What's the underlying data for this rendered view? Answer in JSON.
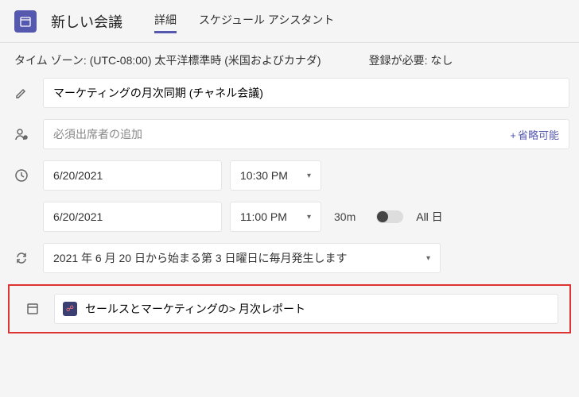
{
  "header": {
    "title": "新しい会議",
    "tabs": {
      "details": "詳細",
      "assistant": "スケジュール アシスタント"
    }
  },
  "subbar": {
    "tz_label": "タイム ゾーン:",
    "tz_value": "(UTC-08:00) 太平洋標準時 (米国およびカナダ)",
    "reg_label": "登録が必要:",
    "reg_value": "なし"
  },
  "form": {
    "title_value": "マーケティングの月次同期 (チャネル会議)",
    "attendees_placeholder": "必須出席者の追加",
    "optional_label": "省略可能",
    "start_date": "6/20/2021",
    "start_time": "10:30 PM",
    "end_date": "6/20/2021",
    "end_time": "11:00 PM",
    "duration": "30m",
    "allday": "All 日",
    "recurrence": "2021 年 6 月 20 日から始まる第 3 日曜日に毎月発生します",
    "channel": "セールスとマーケティングの&gt;    月次レポート"
  }
}
